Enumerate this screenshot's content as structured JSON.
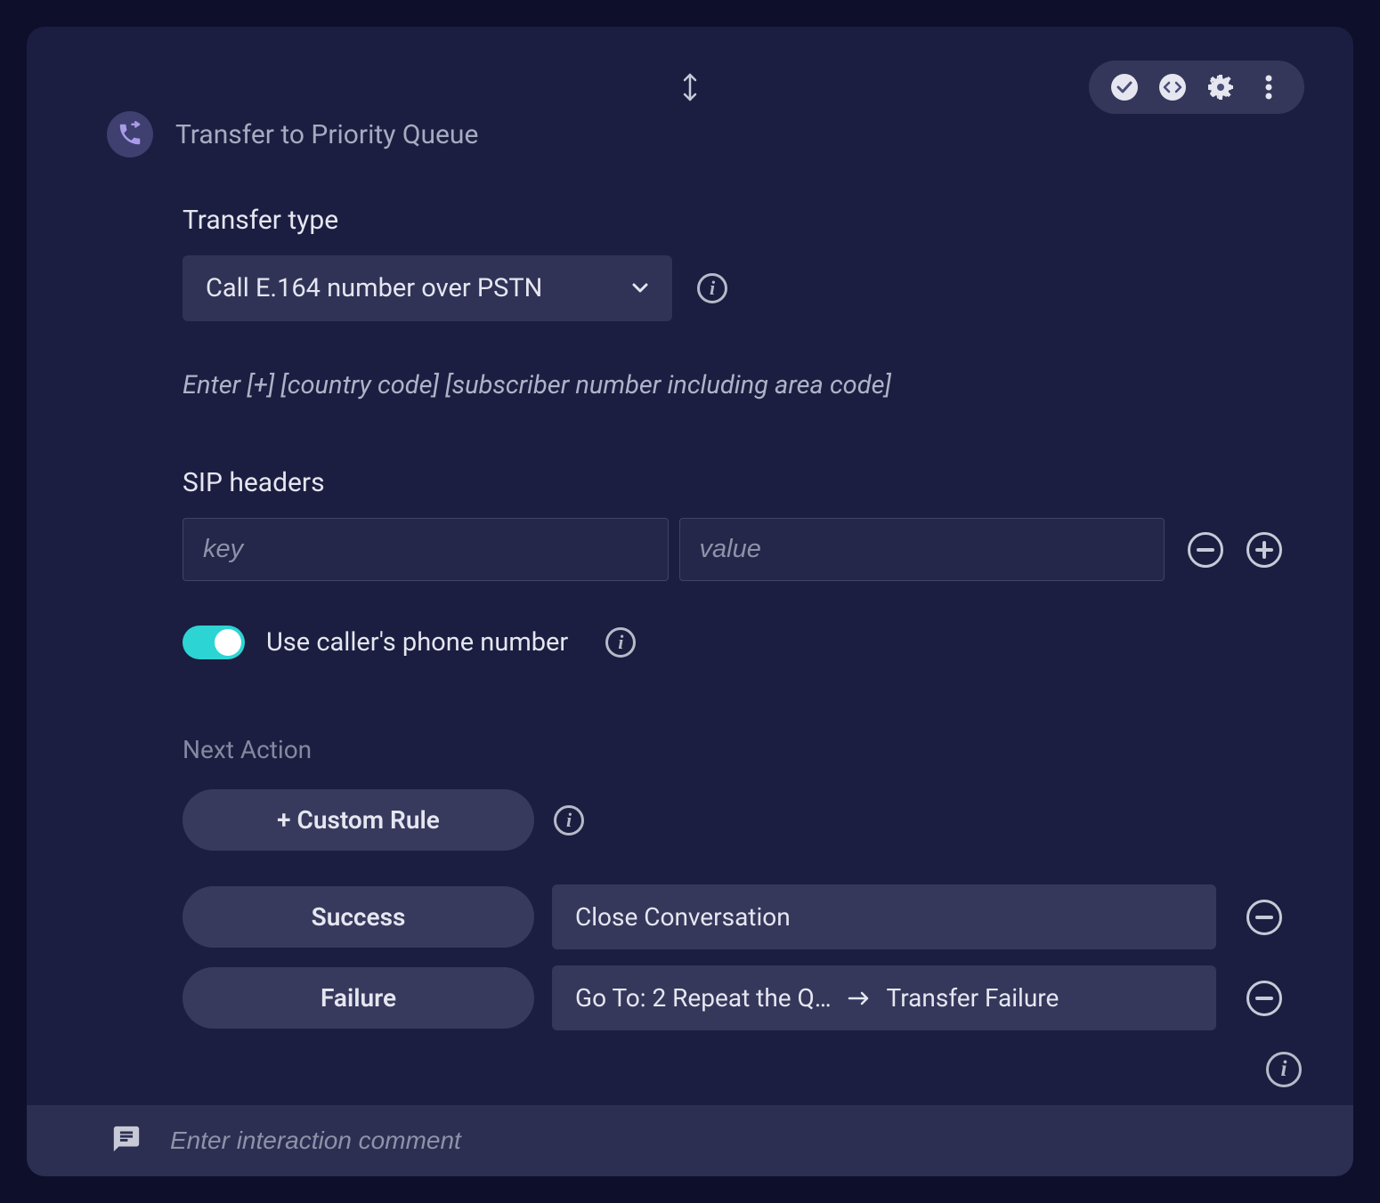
{
  "header": {
    "title": "Transfer to Priority Queue"
  },
  "transferType": {
    "label": "Transfer type",
    "value": "Call E.164 number over PSTN",
    "hint": "Enter [+] [country code] [subscriber number including area code]"
  },
  "sipHeaders": {
    "label": "SIP headers",
    "keyPlaceholder": "key",
    "valuePlaceholder": "value"
  },
  "useCallerNumber": {
    "label": "Use caller's phone number",
    "enabled": true
  },
  "nextAction": {
    "label": "Next Action",
    "customRuleLabel": "+ Custom Rule",
    "rows": [
      {
        "label": "Success",
        "valueParts": [
          "Close Conversation"
        ]
      },
      {
        "label": "Failure",
        "valueParts": [
          "Go To: 2 Repeat the Q…",
          "Transfer Failure"
        ]
      }
    ]
  },
  "commentBar": {
    "placeholder": "Enter interaction comment"
  }
}
